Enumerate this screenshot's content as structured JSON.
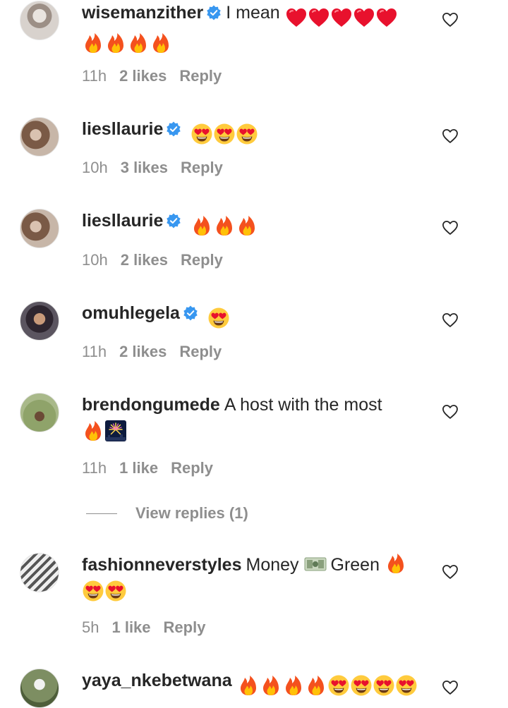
{
  "comments": [
    {
      "username": "wisemanzither",
      "verified": true,
      "text": "I mean",
      "emojis": [
        "heart",
        "heart",
        "heart",
        "heart",
        "heart",
        "fire",
        "fire",
        "fire",
        "fire"
      ],
      "time": "11h",
      "likes": "2 likes",
      "reply": "Reply",
      "avatar_color": "#b9b2ac"
    },
    {
      "username": "liesllaurie",
      "verified": true,
      "text": "",
      "emojis": [
        "heart-eyes",
        "heart-eyes",
        "heart-eyes"
      ],
      "time": "10h",
      "likes": "3 likes",
      "reply": "Reply",
      "avatar_color": "#8b6a55"
    },
    {
      "username": "liesllaurie",
      "verified": true,
      "text": "",
      "emojis": [
        "fire",
        "fire",
        "fire"
      ],
      "time": "10h",
      "likes": "2 likes",
      "reply": "Reply",
      "avatar_color": "#8b6a55"
    },
    {
      "username": "omuhlegela",
      "verified": true,
      "text": "",
      "emojis": [
        "heart-eyes"
      ],
      "time": "11h",
      "likes": "2 likes",
      "reply": "Reply",
      "avatar_color": "#4b4252"
    },
    {
      "username": "brendongumede",
      "verified": false,
      "text": "A host with the most",
      "emojis": [
        "fire",
        "fireworks"
      ],
      "time": "11h",
      "likes": "1 like",
      "reply": "Reply",
      "avatar_color": "#6f8a4e"
    },
    {
      "username": "fashionneverstyles",
      "verified": false,
      "text": "Money",
      "text2": "Green",
      "emojis": [
        "heart-eyes",
        "heart-eyes"
      ],
      "time": "5h",
      "likes": "1 like",
      "reply": "Reply",
      "avatar_color": "#5a5a5a"
    },
    {
      "username": "yaya_nkebetwana",
      "verified": false,
      "text": "",
      "emojis": [
        "fire",
        "fire",
        "fire",
        "fire",
        "heart-eyes",
        "heart-eyes",
        "heart-eyes",
        "heart-eyes"
      ],
      "time": "",
      "likes": "",
      "reply": "",
      "avatar_color": "#7d8e62"
    }
  ],
  "view_replies": {
    "label": "View replies (1)"
  },
  "colors": {
    "verified": "#3897f0",
    "meta": "#8e8e8e",
    "text": "#262626"
  }
}
